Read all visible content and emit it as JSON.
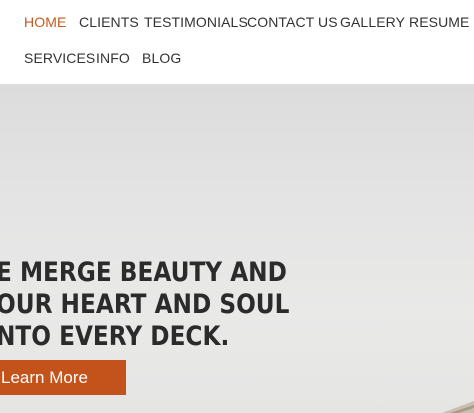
{
  "nav": {
    "items": [
      {
        "label": "HOME",
        "active": true
      },
      {
        "label": "CLIENTS"
      },
      {
        "label": "TESTIMONIALS"
      },
      {
        "label": "CONTACT US"
      },
      {
        "label": "GALLERY"
      },
      {
        "label": "RESUME"
      },
      {
        "label": "SERVICES"
      },
      {
        "label": "INFO"
      },
      {
        "label": "BLOG"
      }
    ]
  },
  "hero": {
    "lines": [
      "E MERGE BEAUTY AND",
      "OUR HEART AND SOUL",
      "NTO EVERY DECK."
    ],
    "cta_label": "Learn More"
  },
  "colors": {
    "accent": "#c4531b",
    "text": "#333333",
    "hero_background": "#e4e4e4"
  }
}
